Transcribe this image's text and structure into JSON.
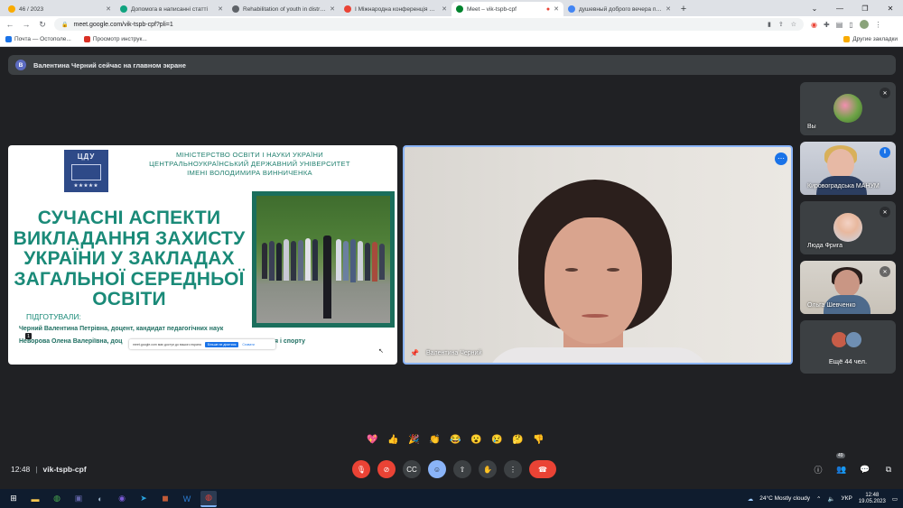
{
  "browser": {
    "tabs": [
      {
        "label": "46 / 2023",
        "color": "#f9ab00"
      },
      {
        "label": "Допомога в написанні статті",
        "color": "#10a37f"
      },
      {
        "label": "Rehabilitation of youth in distress",
        "color": "#5f6368"
      },
      {
        "label": "І Міжнародна конференція ЦДУ",
        "color": "#ea4335"
      },
      {
        "label": "Meet – vik-tspb-cpf",
        "color": "#00832d",
        "active": true
      },
      {
        "label": "душевный доброго вечера пну",
        "color": "#4285f4"
      }
    ],
    "url": "meet.google.com/vik-tspb-cpf?pli=1",
    "bookmarks": [
      {
        "label": "Почта — Остополе...",
        "color": "#1a73e8"
      },
      {
        "label": "Просмотр инструк...",
        "color": "#d93025"
      }
    ],
    "other_bookmarks": "Другие закладки"
  },
  "meet": {
    "banner": {
      "avatar_letter": "В",
      "text": "Валентина Черний сейчас на главном экране"
    },
    "slide": {
      "logo_text": "ЦДУ",
      "ministry": [
        "МІНІСТЕРСТВО ОСВІТИ І НАУКИ УКРАЇНИ",
        "ЦЕНТРАЛЬНОУКРАЇНСЬКИЙ ДЕРЖАВНИЙ УНІВЕРСИТЕТ",
        "ІМЕНІ ВОЛОДИМИРА ВИННИЧЕНКА"
      ],
      "title_lines": [
        "СУЧАСНІ АСПЕКТИ",
        "ВИКЛАДАННЯ ЗАХИСТУ",
        "УКРАЇНИ У ЗАКЛАДАХ",
        "ЗАГАЛЬНОЇ СЕРЕДНЬОЇ",
        "ОСВІТИ"
      ],
      "prepared": "ПІДГОТУВАЛИ:",
      "author1": "Черний Валентина Петрівна, доцент, кандидат педагогічних наук",
      "author2": "Неворова Олена Валеріївна, доц",
      "author2_tail": "я і спорту",
      "page_badge": "1",
      "share_bar": {
        "text": "meet.google.com має доступ до вашого екрана",
        "stop": "Більше не ділитися",
        "hide": "Сховати"
      }
    },
    "main_video": {
      "name": "Валентина Черний",
      "more_icon": "⋯"
    },
    "participants": [
      {
        "name": "Вы",
        "mic": "off"
      },
      {
        "name": "Кировоградська МАНУМ",
        "mic": "speaking"
      },
      {
        "name": "Люда Фрига",
        "mic": "off"
      },
      {
        "name": "Ольга Шевченко",
        "mic": "off"
      }
    ],
    "more_participants": "Ещё 44 чел.",
    "reactions": [
      "💖",
      "👍",
      "🎉",
      "👏",
      "😂",
      "😮",
      "😢",
      "🤔",
      "👎"
    ],
    "time": "12:48",
    "separator": "|",
    "meeting_code": "vik-tspb-cpf",
    "people_count": "49",
    "colors": {
      "accent": "#8ab4f8",
      "danger": "#ea4335",
      "surface": "#3c4043",
      "background": "#202124",
      "slide_green": "#1a8a78"
    }
  },
  "taskbar": {
    "weather": "24°C  Mostly cloudy",
    "lang": "УКР",
    "time": "12:48",
    "date": "19.05.2023"
  }
}
